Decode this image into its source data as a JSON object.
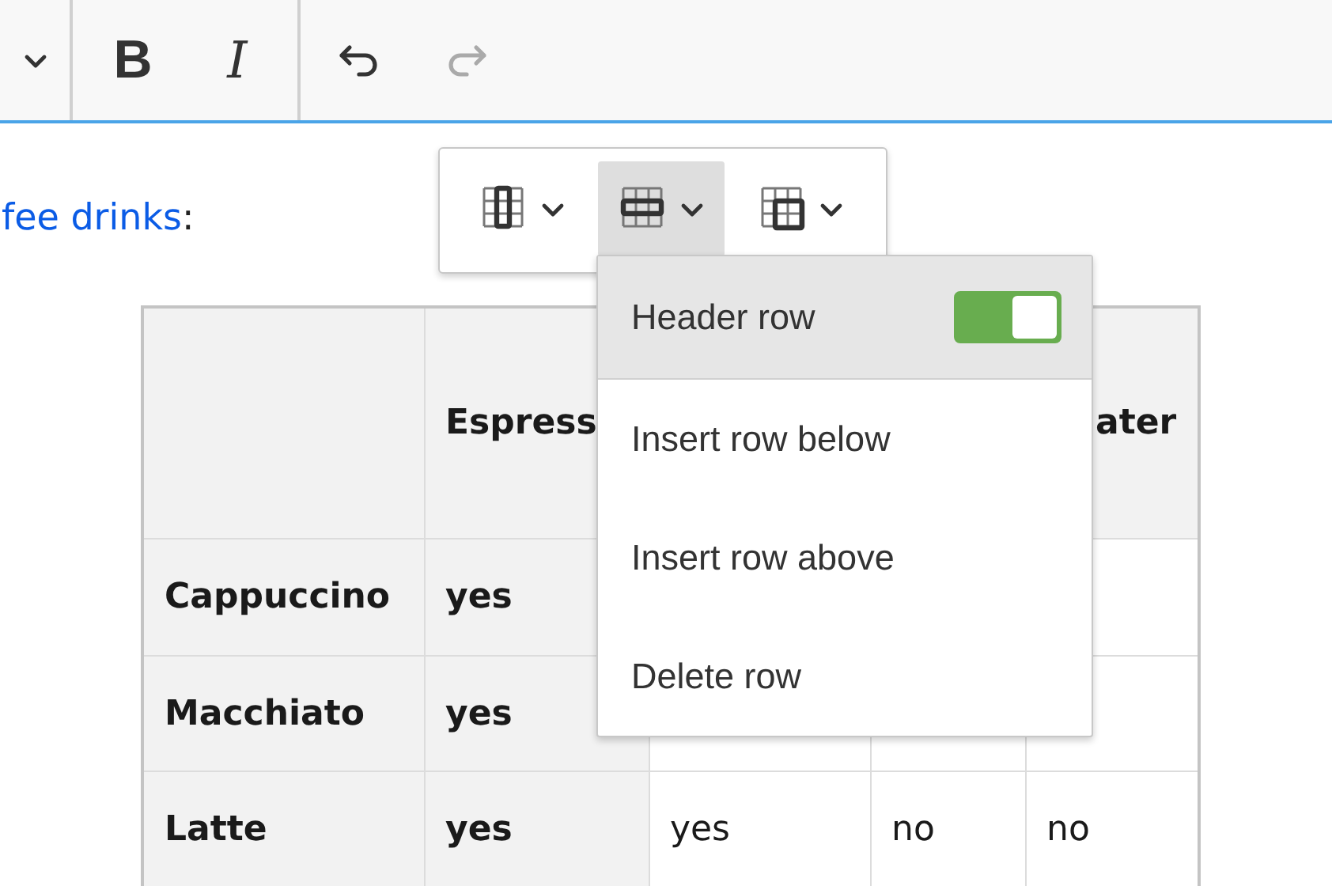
{
  "toolbar": {
    "groups": [
      [
        {
          "kind": "caret",
          "disabled": false
        }
      ],
      [
        {
          "kind": "bold",
          "label": "B",
          "disabled": false
        },
        {
          "kind": "italic",
          "label": "I",
          "disabled": false
        }
      ],
      [
        {
          "kind": "undo",
          "disabled": false
        },
        {
          "kind": "redo",
          "disabled": true
        }
      ]
    ]
  },
  "paragraph": {
    "parts": [
      {
        "kind": "link",
        "text": "fee drinks"
      },
      {
        "kind": "text",
        "text": ":"
      }
    ]
  },
  "table": {
    "rows": [
      {
        "cells": [
          {
            "header": true
          },
          {
            "header": true,
            "text": "Espress"
          },
          null,
          null,
          {
            "header": true,
            "text": "ater"
          }
        ]
      },
      {
        "cells": [
          {
            "header": true,
            "text": "Cappuccino"
          },
          {
            "header": true,
            "text": "yes"
          },
          null,
          null,
          null
        ]
      },
      {
        "cells": [
          {
            "header": true,
            "text": "Macchiato"
          },
          {
            "header": true,
            "text": "yes"
          },
          null,
          null,
          null
        ]
      },
      {
        "cells": [
          {
            "header": true,
            "text": "Latte"
          },
          {
            "header": true,
            "text": "yes"
          },
          {
            "header": false,
            "text": "yes"
          },
          {
            "header": false,
            "text": "no"
          },
          {
            "header": false,
            "text": "no"
          }
        ]
      }
    ]
  },
  "balloon": {
    "buttons": [
      {
        "kind": "column",
        "selected": false
      },
      {
        "kind": "row",
        "selected": true
      },
      {
        "kind": "merge",
        "selected": false
      }
    ],
    "menu": {
      "items": [
        {
          "kind": "toggle",
          "label": "Header row",
          "on": true,
          "selected": true
        },
        {
          "kind": "action",
          "label": "Insert row below",
          "selected": false
        },
        {
          "kind": "action",
          "label": "Insert row above",
          "selected": false
        },
        {
          "kind": "action",
          "label": "Delete row",
          "selected": false
        }
      ]
    }
  }
}
